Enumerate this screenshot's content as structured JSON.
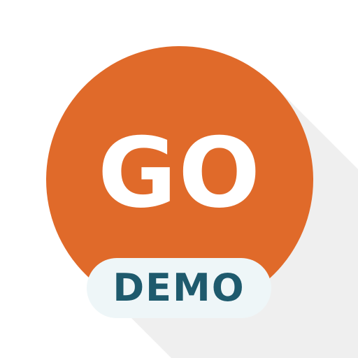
{
  "logo": {
    "primary_text": "GO",
    "badge_text": "DEMO",
    "colors": {
      "circle": "#e06a2a",
      "primary_text": "#ffffff",
      "badge_background": "#eef6f8",
      "badge_text": "#1e5a6d",
      "shadow": "#ececec"
    }
  }
}
